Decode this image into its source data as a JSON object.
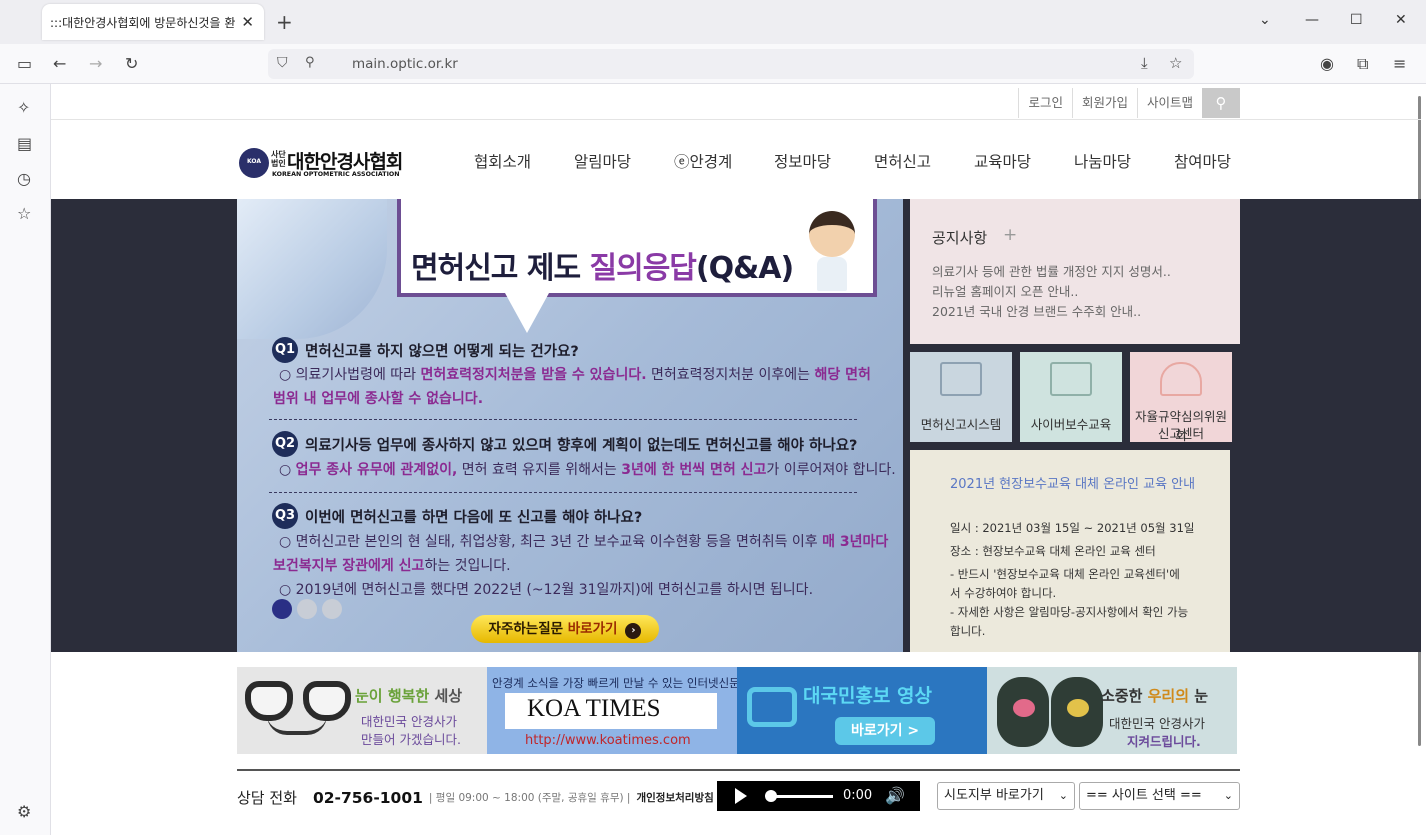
{
  "browser": {
    "tab_title": ":::대한안경사협회에 방문하신것을 환",
    "url": "main.optic.or.kr"
  },
  "utility": {
    "login": "로그인",
    "join": "회원가입",
    "sitemap": "사이트맵"
  },
  "logo": {
    "small_top": "사단",
    "small_bottom": "법인",
    "name": "대한안경사협회",
    "sub": "KOREAN OPTOMETRIC ASSOCIATION",
    "mark": "KOA"
  },
  "nav": [
    "협회소개",
    "알림마당",
    "ⓔ안경계",
    "정보마당",
    "면허신고",
    "교육마당",
    "나눔마당",
    "참여마당"
  ],
  "banner": {
    "title_a": "면허신고 제도 ",
    "title_b": "질의응답",
    "title_c": "(Q&A)",
    "q1_num": "Q1",
    "q1": "면허신고를 하지 않으면 어떻게 되는 건가요?",
    "a1_line1_a": "○ 의료기사법령에 따라 ",
    "a1_line1_b": "면허효력정지처분을 받을 수 있습니다.",
    "a1_line1_c": " 면허효력정지처분 이후에는 ",
    "a1_line1_d": "해당 면허",
    "a1_line2": "범위 내 업무에 종사할 수 없습니다.",
    "q2_num": "Q2",
    "q2": "의료기사등 업무에 종사하지 않고 있으며 향후에 계획이 없는데도 면허신고를 해야 하나요?",
    "a2_a": "○ ",
    "a2_b": "업무 종사 유무에 관계없이,",
    "a2_c": " 면허 효력 유지를 위해서는 ",
    "a2_d": "3년에 한 번씩 면허 신고",
    "a2_e": "가 이루어져야 합니다.",
    "q3_num": "Q3",
    "q3": "이번에 면허신고를 하면 다음에 또 신고를 해야 하나요?",
    "a3_line1_a": "○ 면허신고란 본인의 현 실태, 취업상황, 최근 3년 간 보수교육 이수현황 등을 면허취득 이후 ",
    "a3_line1_b": "매 3년마다",
    "a3_line2_a": "보건복지부 장관에게 신고",
    "a3_line2_b": "하는 것입니다.",
    "a3_line3": "○ 2019년에 면허신고를 했다면 2022년 (~12월 31일까지)에 면허신고를 하시면 됩니다.",
    "faq_a": "자주하는질문 ",
    "faq_b": "바로가기",
    "faq_arrow": "›"
  },
  "notice": {
    "title": "공지사항",
    "plus": "+",
    "items": [
      "의료기사 등에 관한 법률 개정안 지지 성명서..",
      "리뉴얼 홈페이지 오픈 안내..",
      "2021년 국내 안경 브랜드 수주회 안내.."
    ]
  },
  "quick": [
    {
      "label": "면허신고시스템",
      "bg": "#c9d6df"
    },
    {
      "label": "사이버보수교육",
      "bg": "#cfe3df"
    },
    {
      "label_line1": "자율규약심의위원회",
      "label_line2": "신고센터",
      "bg": "#f1d6d8"
    }
  ],
  "edu": {
    "title": "2021년 현장보수교육 대체 온라인 교육 안내",
    "date": "일시 : 2021년 03월 15일 ~ 2021년 05월 31일",
    "place": "장소 : 현장보수교육 대체 온라인 교육 센터",
    "note1": "- 반드시 '현장보수교육 대체 온라인 교육센터'에서 수강하여야 합니다.",
    "note2": "- 자세한 사항은 알림마당-공지사항에서 확인 가능합니다."
  },
  "ads": {
    "ad1_a": "눈이 ",
    "ad1_b": "행복한",
    "ad1_c": " 세상",
    "ad1_line1": "대한민국 안경사가",
    "ad1_line2": "만들어 가겠습니다.",
    "ad2_top": "안경계 소식을 가장 빠르게 만날 수 있는 인터넷신문",
    "ad2_name": "KOA TIMES",
    "ad2_url": "http://www.koatimes.com",
    "ad3_title": "대국민홍보 영상",
    "ad3_btn": "바로가기 >",
    "ad4_a": "소중한 ",
    "ad4_b": "우리의",
    "ad4_c": " 눈",
    "ad4_line1": "대한민국 안경사가",
    "ad4_line2": "지켜드립니다."
  },
  "footer": {
    "contact_label": "상담 전화",
    "contact_num": "02-756-1001",
    "hours": "| 평일 09:00 ~ 18:00 (주말, 공휴일 휴무) |",
    "privacy": "개인정보처리방침",
    "audio_time": "0:00",
    "select1": "시도지부 바로가기",
    "select2": "== 사이트 선택 =="
  },
  "colors": {
    "accent_purple": "#8a3aa6",
    "navy": "#1e2d5a",
    "dark_bg": "#2b2d3a"
  }
}
